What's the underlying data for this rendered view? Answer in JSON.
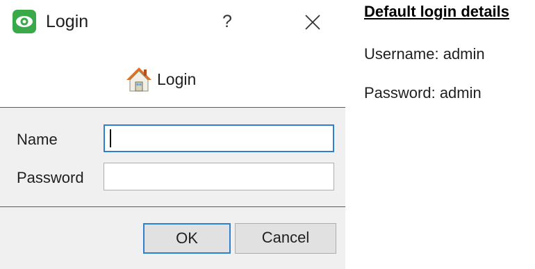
{
  "dialog": {
    "title": "Login",
    "help_label": "?",
    "header_title": "Login",
    "icons": {
      "app": "eye-icon",
      "header": "home-icon",
      "close": "close-icon"
    },
    "colors": {
      "app_icon": "#3aa94a",
      "focus_border": "#2f7fd0",
      "panel_bg": "#f0f0f0"
    }
  },
  "form": {
    "name_label": "Name",
    "name_value": "",
    "password_label": "Password",
    "password_value": ""
  },
  "buttons": {
    "ok_label": "OK",
    "cancel_label": "Cancel"
  },
  "notes": {
    "title": "Default login details",
    "username_line": "Username: admin",
    "password_line": "Password: admin"
  }
}
